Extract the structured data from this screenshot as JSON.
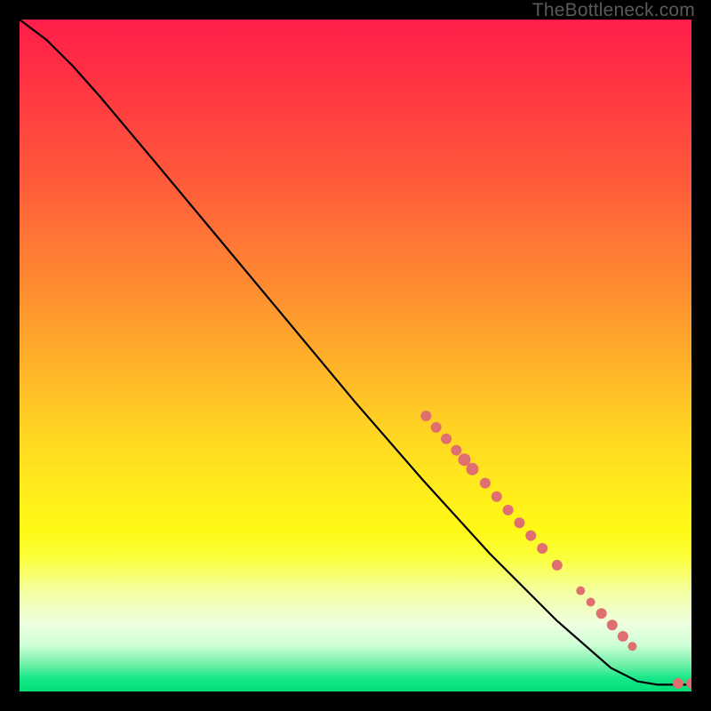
{
  "watermark": "TheBottleneck.com",
  "chart_data": {
    "type": "line",
    "title": "",
    "xlabel": "",
    "ylabel": "",
    "xlim": [
      0,
      100
    ],
    "ylim": [
      0,
      100
    ],
    "curve": {
      "name": "bottleneck-curve",
      "points": [
        {
          "x": 0,
          "y": 100
        },
        {
          "x": 4,
          "y": 97
        },
        {
          "x": 8,
          "y": 93
        },
        {
          "x": 12,
          "y": 88.5
        },
        {
          "x": 20,
          "y": 79
        },
        {
          "x": 30,
          "y": 67
        },
        {
          "x": 40,
          "y": 55
        },
        {
          "x": 50,
          "y": 43
        },
        {
          "x": 60,
          "y": 31.5
        },
        {
          "x": 70,
          "y": 20.5
        },
        {
          "x": 80,
          "y": 10.5
        },
        {
          "x": 88,
          "y": 3.5
        },
        {
          "x": 92,
          "y": 1.5
        },
        {
          "x": 95,
          "y": 1.0
        },
        {
          "x": 100,
          "y": 1.0
        }
      ]
    },
    "markers": {
      "name": "highlighted-points",
      "color": "#e07070",
      "points": [
        {
          "x": 60.5,
          "y": 41.0,
          "r": 6
        },
        {
          "x": 62.0,
          "y": 39.3,
          "r": 6
        },
        {
          "x": 63.5,
          "y": 37.6,
          "r": 6
        },
        {
          "x": 65.0,
          "y": 35.9,
          "r": 6
        },
        {
          "x": 66.2,
          "y": 34.5,
          "r": 7
        },
        {
          "x": 67.4,
          "y": 33.1,
          "r": 7
        },
        {
          "x": 69.3,
          "y": 31.0,
          "r": 6
        },
        {
          "x": 71.0,
          "y": 29.0,
          "r": 6
        },
        {
          "x": 72.7,
          "y": 27.0,
          "r": 6
        },
        {
          "x": 74.4,
          "y": 25.1,
          "r": 6
        },
        {
          "x": 76.1,
          "y": 23.2,
          "r": 6
        },
        {
          "x": 77.8,
          "y": 21.3,
          "r": 6
        },
        {
          "x": 80.0,
          "y": 18.8,
          "r": 6
        },
        {
          "x": 83.5,
          "y": 15.0,
          "r": 5
        },
        {
          "x": 85.0,
          "y": 13.3,
          "r": 5
        },
        {
          "x": 86.6,
          "y": 11.6,
          "r": 6
        },
        {
          "x": 88.2,
          "y": 9.9,
          "r": 6
        },
        {
          "x": 89.8,
          "y": 8.2,
          "r": 6
        },
        {
          "x": 91.2,
          "y": 6.7,
          "r": 5
        },
        {
          "x": 98.0,
          "y": 1.2,
          "r": 6
        },
        {
          "x": 100.0,
          "y": 1.2,
          "r": 6
        }
      ]
    }
  }
}
